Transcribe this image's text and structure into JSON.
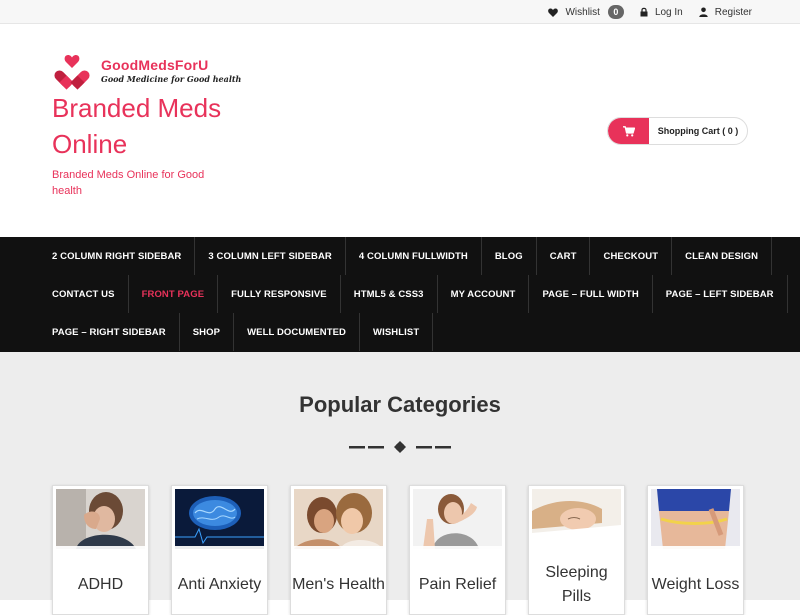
{
  "topbar": {
    "wishlist_label": "Wishlist",
    "wishlist_count": "0",
    "login_label": "Log In",
    "register_label": "Register"
  },
  "header": {
    "logo_brand": "GoodMedsForU",
    "logo_tagline": "Good Medicine for Good health",
    "site_title": "Branded Meds Online",
    "site_description": "Branded Meds Online for Good health",
    "cart_label": "Shopping Cart ( 0 )"
  },
  "nav": {
    "rows": [
      [
        "2 COLUMN RIGHT SIDEBAR",
        "3 COLUMN LEFT SIDEBAR",
        "4 COLUMN FULLWIDTH",
        "BLOG",
        "CART",
        "CHECKOUT",
        "CLEAN DESIGN"
      ],
      [
        "CONTACT US",
        "FRONT PAGE",
        "FULLY RESPONSIVE",
        "HTML5 & CSS3",
        "MY ACCOUNT",
        "PAGE – FULL WIDTH",
        "PAGE – LEFT SIDEBAR"
      ],
      [
        "PAGE – RIGHT SIDEBAR",
        "SHOP",
        "WELL DOCUMENTED",
        "WISHLIST"
      ]
    ],
    "active": "FRONT PAGE"
  },
  "main": {
    "section_title": "Popular Categories",
    "categories": [
      {
        "label": "ADHD",
        "image": "person-holding-head-image"
      },
      {
        "label": "Anti Anxiety",
        "image": "brain-scan-image"
      },
      {
        "label": "Men's Health",
        "image": "couple-image"
      },
      {
        "label": "Pain Relief",
        "image": "neck-pain-image"
      },
      {
        "label": "Sleeping Pills",
        "image": "sleeping-woman-image"
      },
      {
        "label": "Weight Loss",
        "image": "waist-measure-image"
      }
    ]
  },
  "colors": {
    "accent": "#e8325a",
    "nav_bg": "#111111",
    "content_bg": "#ededed"
  }
}
